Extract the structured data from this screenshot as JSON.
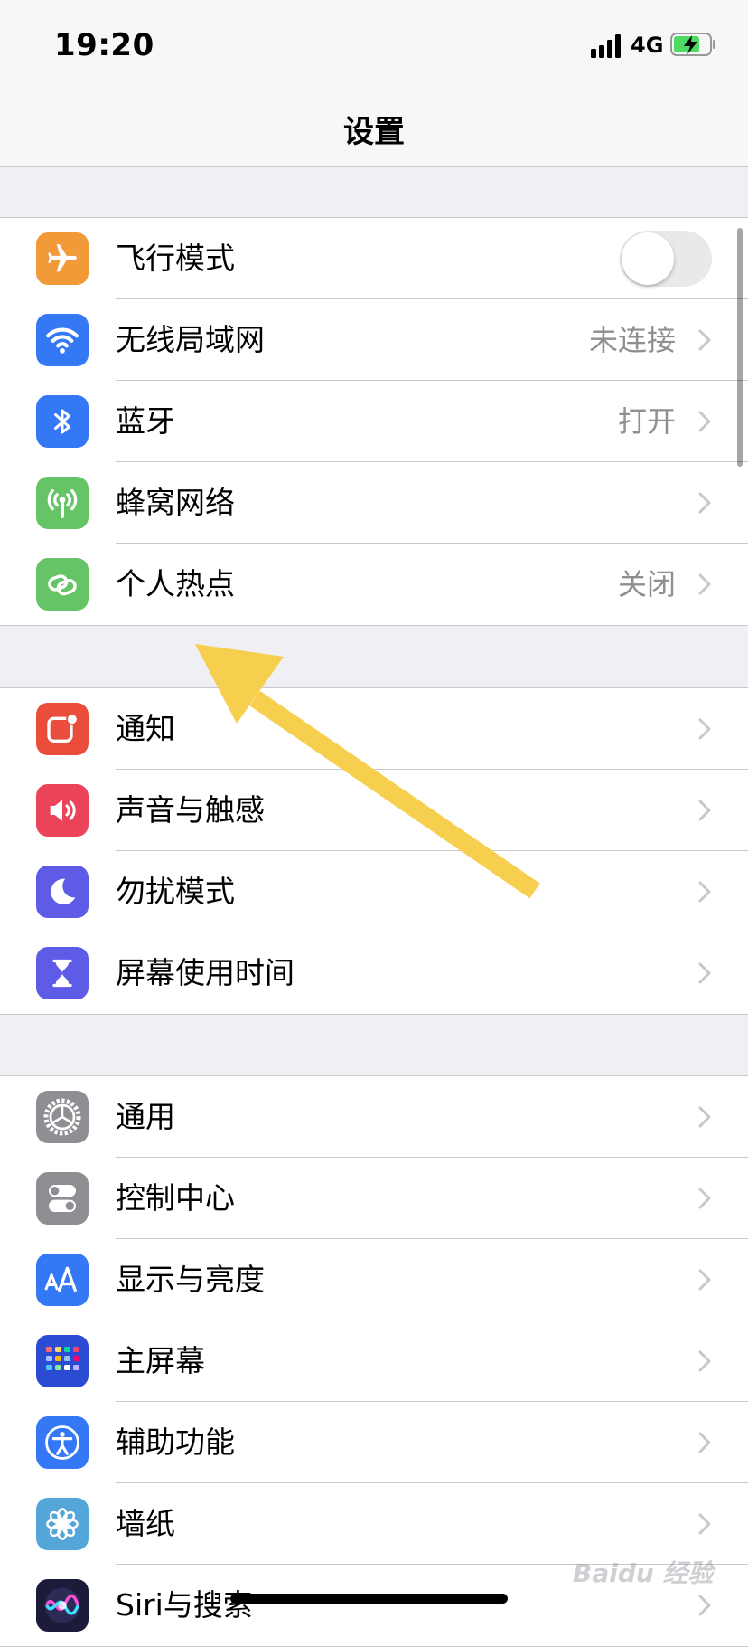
{
  "status_bar": {
    "time": "19:20",
    "network": "4G"
  },
  "nav": {
    "title": "设置"
  },
  "groups": [
    {
      "rows": [
        {
          "label": "飞行模式",
          "icon": "airplane-icon",
          "color": "#f19a37",
          "toggle": false
        },
        {
          "label": "无线局域网",
          "icon": "wifi-icon",
          "color": "#3478f6",
          "value": "未连接"
        },
        {
          "label": "蓝牙",
          "icon": "bluetooth-icon",
          "color": "#3478f6",
          "value": "打开"
        },
        {
          "label": "蜂窝网络",
          "icon": "antenna-icon",
          "color": "#65c466"
        },
        {
          "label": "个人热点",
          "icon": "hotspot-chain-icon",
          "color": "#65c466",
          "value": "关闭"
        }
      ]
    },
    {
      "rows": [
        {
          "label": "通知",
          "icon": "notification-icon",
          "color": "#eb4d3d"
        },
        {
          "label": "声音与触感",
          "icon": "speaker-icon",
          "color": "#eb445a"
        },
        {
          "label": "勿扰模式",
          "icon": "moon-icon",
          "color": "#5e5ce6"
        },
        {
          "label": "屏幕使用时间",
          "icon": "hourglass-icon",
          "color": "#5e5ce6"
        }
      ]
    },
    {
      "rows": [
        {
          "label": "通用",
          "icon": "gear-icon",
          "color": "#8e8e93"
        },
        {
          "label": "控制中心",
          "icon": "switches-icon",
          "color": "#8e8e93"
        },
        {
          "label": "显示与亮度",
          "icon": "text-size-icon",
          "color": "#3478f6"
        },
        {
          "label": "主屏幕",
          "icon": "home-screen-grid-icon",
          "color": "#2c4bd3"
        },
        {
          "label": "辅助功能",
          "icon": "accessibility-icon",
          "color": "#3478f6"
        },
        {
          "label": "墙纸",
          "icon": "flower-icon",
          "color": "#54a6d9"
        },
        {
          "label": "Siri与搜索",
          "icon": "siri-icon",
          "color": "#1c1c3a"
        }
      ]
    }
  ],
  "watermark": {
    "text": "Baidu 经验"
  },
  "colors": {
    "annotation_arrow": "#f7cf4f",
    "chevron": "#c7c7cc",
    "secondary_text": "#8e8e93"
  }
}
